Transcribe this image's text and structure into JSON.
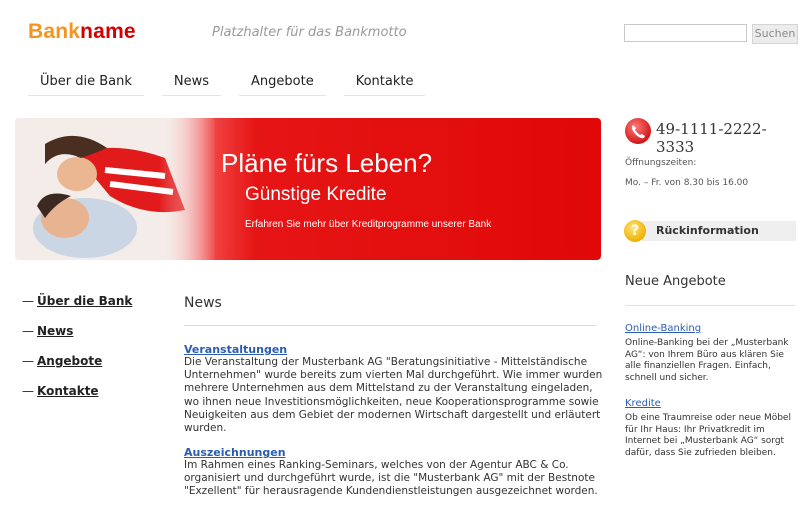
{
  "header": {
    "logo_part1": "Bank",
    "logo_part2": "name",
    "motto": "Platzhalter für das Bankmotto",
    "search_placeholder": "",
    "search_button": "Suchen"
  },
  "topnav": [
    "Über die Bank",
    "News",
    "Angebote",
    "Kontakte"
  ],
  "banner": {
    "title": "Pläne fürs Leben?",
    "subtitle": "Günstige Kredite",
    "text": "Erfahren Sie mehr über Kreditprogramme unserer Bank"
  },
  "sidebar_left": [
    "Über die Bank",
    "News",
    "Angebote",
    "Kontakte"
  ],
  "main": {
    "heading": "News",
    "articles": [
      {
        "title": "Veranstaltungen",
        "body": "Die Veranstaltung der Musterbank AG \"Beratungsinitiative - Mittelständische Unternehmen\" wurde bereits zum vierten Mal durchgeführt. Wie immer wurden mehrere Unternehmen aus dem Mittelstand zu der Veranstaltung eingeladen, wo ihnen neue Investitionsmöglichkeiten, neue Kooperationsprogramme sowie Neuigkeiten aus dem Gebiet der modernen Wirtschaft dargestellt und erläutert wurden."
      },
      {
        "title": "Auszeichnungen",
        "body": "Im Rahmen eines Ranking-Seminars, welches von der Agentur ABC & Co. organisiert und durchgeführt wurde, ist die \"Musterbank AG\" mit der Bestnote \"Exzellent\" für herausragende Kundendienstleistungen ausgezeichnet worden."
      }
    ]
  },
  "sidebar_right": {
    "phone": "49-1111-2222-3333",
    "hours_label": "Öffnungszeiten:",
    "hours_value": "Mo. – Fr. von 8.30 bis 16.00",
    "feedback_label": "Rückinformation",
    "offers_heading": "Neue Angebote",
    "offers": [
      {
        "title": "Online-Banking",
        "desc": "Online-Banking bei der „Musterbank AG“: von Ihrem Büro aus klären Sie alle finanziellen Fragen. Einfach, schnell und sicher."
      },
      {
        "title": "Kredite",
        "desc": "Ob eine Traumreise oder neue Möbel für Ihr Haus: Ihr Privatkredit im Internet bei „Musterbank AG“ sorgt dafür, dass Sie zufrieden bleiben."
      }
    ]
  },
  "colors": {
    "logo_orange": "#f7941d",
    "logo_red": "#d40000",
    "banner_red": "#e00808",
    "link_blue": "#2a5db0"
  },
  "icons": [
    "phone-icon",
    "question-icon"
  ]
}
